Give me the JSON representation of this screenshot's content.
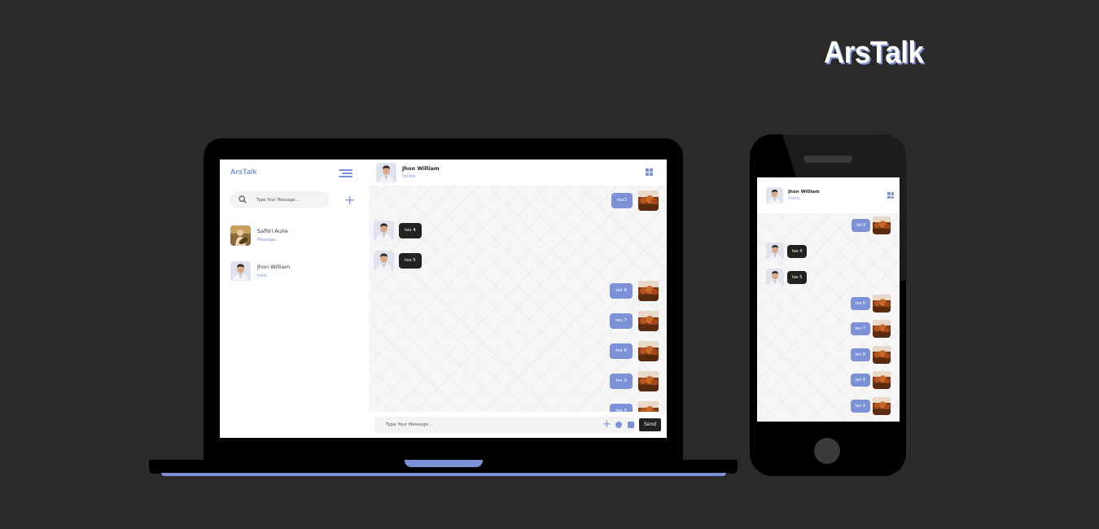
{
  "brand": {
    "title": "ArsTalk"
  },
  "sidebar": {
    "logo": "ArsTalk",
    "search_placeholder": "Type Your Message...",
    "add_label": "+",
    "contacts": [
      {
        "name": "Safitri Aulia",
        "subtitle": "Message...",
        "avatar": "woman-guitar-avatar"
      },
      {
        "name": "Jhon William",
        "subtitle": "hello",
        "avatar": "man-avatar"
      }
    ]
  },
  "chat": {
    "contact_name": "Jhon William",
    "status": "Online",
    "messages": [
      {
        "text": "tes3",
        "direction": "out"
      },
      {
        "text": "tes 4",
        "direction": "in"
      },
      {
        "text": "tes 5",
        "direction": "in"
      },
      {
        "text": "tes 6",
        "direction": "out"
      },
      {
        "text": "tes 7",
        "direction": "out"
      },
      {
        "text": "tes 8",
        "direction": "out"
      },
      {
        "text": "tes 9",
        "direction": "out"
      },
      {
        "text": "tes 9",
        "direction": "out"
      }
    ],
    "input_placeholder": "Type Your Message...",
    "send_label": "Send"
  },
  "mobile": {
    "contact_name": "Jhon William",
    "status": "Online"
  },
  "colors": {
    "background": "#2b292a",
    "accent": "#7d92d6",
    "dark_bubble": "#222222"
  }
}
